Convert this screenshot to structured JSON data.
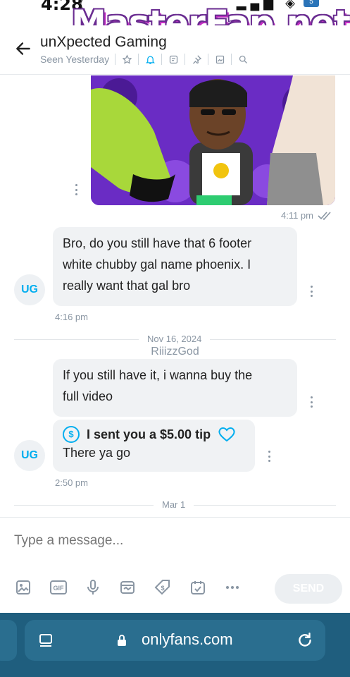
{
  "status_bar": {
    "time": "4:28"
  },
  "watermark": "MasterFap.net",
  "header": {
    "title": "unXpected Gaming",
    "last_seen": "Seen Yesterday"
  },
  "messages": {
    "photo_time": "4:11 pm",
    "m1": {
      "lines": [
        "Bro, do you still have that 6 footer",
        "white chubby gal name phoenix. I",
        "really want that gal bro"
      ],
      "avatar": "UG",
      "time": "4:16 pm"
    },
    "date_divider_1": "Nov 16, 2024",
    "sender_name": "RiiizzGod",
    "m2": {
      "lines": [
        "If you still have it, i wanna buy the",
        "full video"
      ]
    },
    "m3": {
      "tip_text": "I sent you a $5.00 tip",
      "text": "There ya go",
      "avatar": "UG",
      "time": "2:50 pm"
    },
    "date_divider_2": "Mar 1"
  },
  "composer": {
    "placeholder": "Type a message...",
    "send_label": "SEND"
  },
  "browser": {
    "url": "onlyfans.com"
  },
  "colors": {
    "accent": "#00aeef",
    "browser_bar": "#1f5e7e",
    "bubble": "#f0f2f4"
  }
}
